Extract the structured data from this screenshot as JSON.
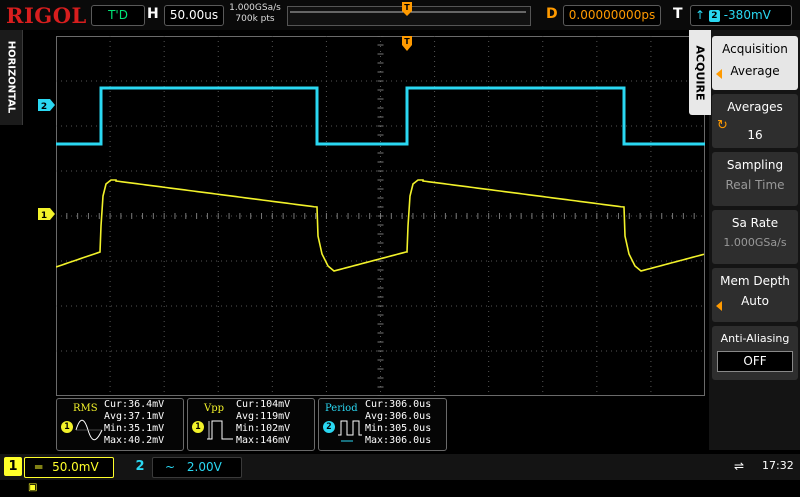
{
  "topbar": {
    "brand": "RIGOL",
    "run_status": "T'D",
    "h_label": "H",
    "timebase": "50.00us",
    "sample_rate": "1.000GSa/s",
    "memory_points": "700k pts",
    "d_label": "D",
    "delay": "0.00000000ps",
    "t_label": "T",
    "trigger_channel": "2",
    "trigger_level": "-380mV",
    "colors": {
      "run": "#00e676",
      "delay": "#ff9a00",
      "ch1": "#ffff2a",
      "ch2": "#2ad8f2"
    }
  },
  "left_tab": {
    "label": "HORIZONTAL"
  },
  "channel_markers": {
    "ch1": "1",
    "ch2": "2"
  },
  "menu": {
    "tab_label": "ACQUIRE",
    "items": [
      {
        "title": "Acquisition",
        "value": "Average"
      },
      {
        "title": "Averages",
        "value": "16"
      },
      {
        "title": "Sampling",
        "value": "Real Time"
      },
      {
        "title": "Sa Rate",
        "value": "1.000GSa/s"
      },
      {
        "title": "Mem Depth",
        "value": "Auto"
      },
      {
        "title": "Anti-Aliasing",
        "value": "OFF"
      }
    ]
  },
  "measurements": [
    {
      "name": "RMS",
      "channel": "1",
      "cur": "Cur:36.4mV",
      "avg": "Avg:37.1mV",
      "min": "Min:35.1mV",
      "max": "Max:40.2mV"
    },
    {
      "name": "Vpp",
      "channel": "1",
      "cur": "Cur:104mV",
      "avg": "Avg:119mV",
      "min": "Min:102mV",
      "max": "Max:146mV"
    },
    {
      "name": "Period",
      "channel": "2",
      "cur": "Cur:306.0us",
      "avg": "Avg:306.0us",
      "min": "Min:305.0us",
      "max": "Max:306.0us"
    }
  ],
  "bottombar": {
    "ch1": {
      "number": "1",
      "coupling": "═",
      "scale": "50.0mV"
    },
    "ch2": {
      "number": "2",
      "coupling": "~",
      "scale": "2.00V"
    },
    "time": "17:32"
  }
}
